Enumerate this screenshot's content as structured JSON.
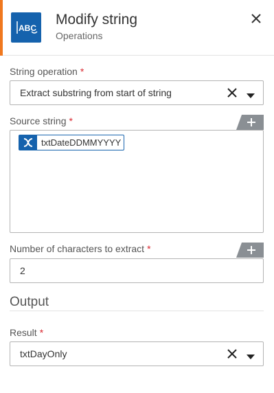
{
  "header": {
    "title": "Modify string",
    "subtitle": "Operations",
    "icon_text": "ABC",
    "accent_color": "#f0781e",
    "icon_bg_color": "#1562ad"
  },
  "string_operation": {
    "label": "String operation",
    "required_mark": "*",
    "value": "Extract substring from start of string"
  },
  "source_string": {
    "label": "Source string",
    "required_mark": "*",
    "chip_label": "txtDateDDMMYYYY",
    "chip_icon": "variable-x-icon"
  },
  "num_chars": {
    "label": "Number of characters to extract",
    "required_mark": "*",
    "value": "2"
  },
  "output": {
    "section_title": "Output"
  },
  "result": {
    "label": "Result",
    "required_mark": "*",
    "value": "txtDayOnly"
  }
}
